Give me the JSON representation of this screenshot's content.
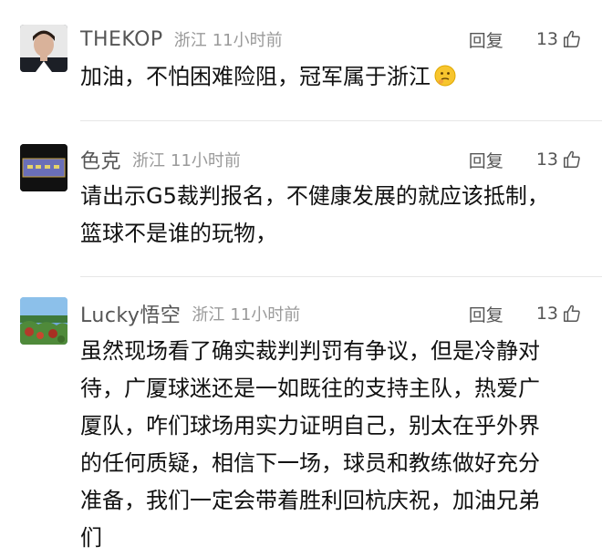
{
  "comments": [
    {
      "username": "THEKOP",
      "region": "浙江",
      "time": "11小时前",
      "reply_label": "回复",
      "likes": "13",
      "text": "加油，不怕困难险阻，冠军属于浙江",
      "emoji": "thinking-face-emoji"
    },
    {
      "username": "色克",
      "region": "浙江",
      "time": "11小时前",
      "reply_label": "回复",
      "likes": "13",
      "text_lines": [
        "请出示G5裁判报名，不健康发展的就应该抵制，",
        "篮球不是谁的玩物，"
      ]
    },
    {
      "username": "Lucky悟空",
      "region": "浙江",
      "time": "11小时前",
      "reply_label": "回复",
      "likes": "13",
      "text_lines": [
        "虽然现场看了确实裁判判罚有争议，但是冷静对",
        "待，广厦球迷还是一如既往的支持主队，热爱广",
        "厦队，咋们球场用实力证明自己，别太在乎外界",
        "的任何质疑，相信下一场，球员和教练做好充分",
        "准备，我们一定会带着胜利回杭庆祝，加油兄弟",
        "们"
      ]
    }
  ],
  "icons": {
    "like": "thumbs-up-icon"
  }
}
